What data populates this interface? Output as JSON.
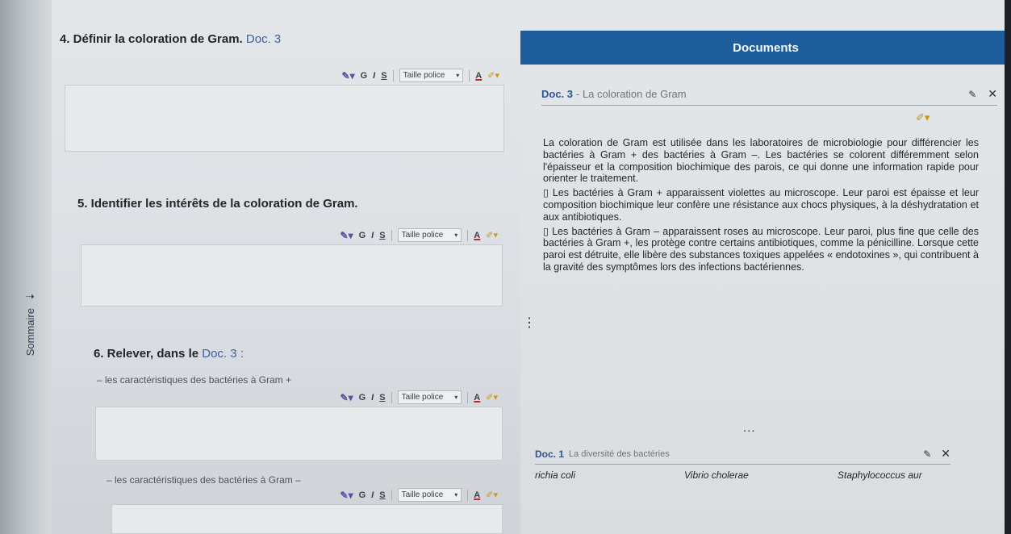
{
  "sidebar": {
    "tab_label": "Sommaire",
    "tab_icon": "arrow-right-icon"
  },
  "questions": {
    "q4": {
      "text": "4. Définir la coloration de Gram.",
      "doc_ref": "Doc. 3"
    },
    "q5": {
      "text": "5. Identifier les intérêts de la coloration de Gram."
    },
    "q6": {
      "text": "6. Relever, dans le",
      "doc_ref": "Doc. 3 :",
      "sub1": "– les caractéristiques des bactéries à Gram +",
      "sub2": "– les caractéristiques des bactéries à Gram –"
    }
  },
  "toolbar": {
    "bold": "G",
    "italic": "I",
    "strike": "S",
    "font_size": "Taille police",
    "text_color": "A",
    "caret": "▾"
  },
  "documents": {
    "header": "Documents",
    "doc3": {
      "number": "Doc. 3",
      "subtitle": "- La coloration de Gram",
      "paragraphs": [
        "La coloration de Gram est utilisée dans les laboratoires de microbiologie pour différencier les bactéries à Gram + des bactéries à Gram –. Les bactéries se colorent différemment selon l'épaisseur et la composition biochimique des parois, ce qui donne une information rapide pour orienter le traitement.",
        "▯ Les bactéries à Gram + apparaissent violettes au microscope. Leur paroi est épaisse et leur composition biochimique leur confère une résistance aux chocs physiques, à la déshydratation et aux antibiotiques.",
        "▯ Les bactéries à Gram – apparaissent roses au microscope. Leur paroi, plus fine que celle des bactéries à Gram +, les protège contre certains antibiotiques, comme la pénicilline. Lorsque cette paroi est détruite, elle libère des substances toxiques appelées « endotoxines », qui contribuent à la gravité des symptômes lors des infections bactériennes."
      ]
    },
    "doc1": {
      "number": "Doc. 1",
      "subtitle": "La diversité des bactéries",
      "bacteria": [
        "richia coli",
        "Vibrio cholerae",
        "Staphylococcus aur"
      ]
    },
    "kebab": "⋮",
    "ellipsis": "..."
  },
  "colors": {
    "header_blue": "#1d5d9c",
    "doc_ref_blue": "#3b5fa0"
  }
}
